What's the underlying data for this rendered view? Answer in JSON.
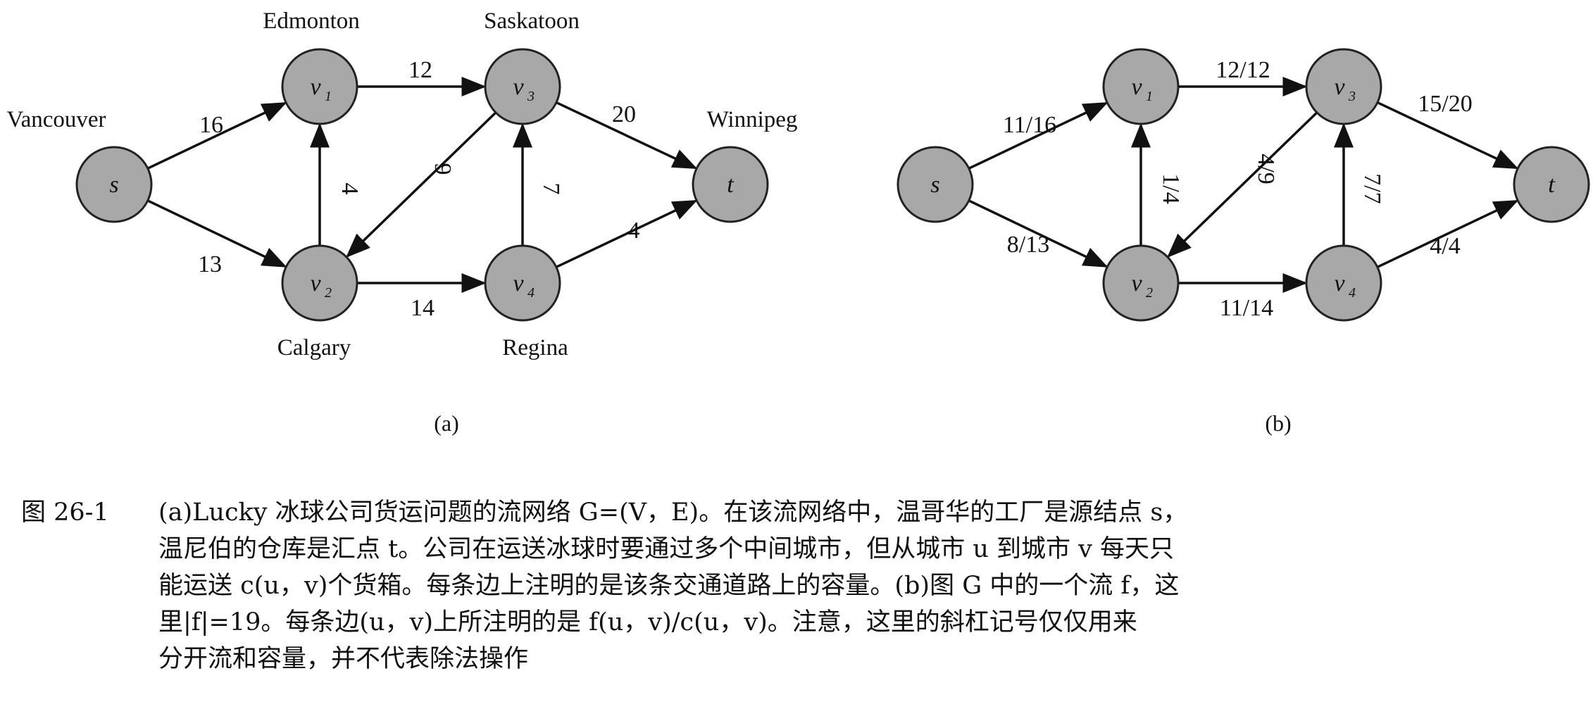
{
  "figure": {
    "panels": [
      {
        "id": "a",
        "panel_label": "(a)",
        "nodes": [
          {
            "id": "s",
            "label": "s",
            "sub": "",
            "city": "Vancouver"
          },
          {
            "id": "v1",
            "label": "v",
            "sub": "1",
            "city": "Edmonton"
          },
          {
            "id": "v2",
            "label": "v",
            "sub": "2",
            "city": "Calgary"
          },
          {
            "id": "v3",
            "label": "v",
            "sub": "3",
            "city": "Saskatoon"
          },
          {
            "id": "v4",
            "label": "v",
            "sub": "4",
            "city": "Regina"
          },
          {
            "id": "t",
            "label": "t",
            "sub": "",
            "city": "Winnipeg"
          }
        ],
        "edges": [
          {
            "from": "s",
            "to": "v1",
            "label": "16"
          },
          {
            "from": "s",
            "to": "v2",
            "label": "13"
          },
          {
            "from": "v2",
            "to": "v1",
            "label": "4"
          },
          {
            "from": "v1",
            "to": "v3",
            "label": "12"
          },
          {
            "from": "v3",
            "to": "v2",
            "label": "9"
          },
          {
            "from": "v2",
            "to": "v4",
            "label": "14"
          },
          {
            "from": "v4",
            "to": "v3",
            "label": "7"
          },
          {
            "from": "v3",
            "to": "t",
            "label": "20"
          },
          {
            "from": "v4",
            "to": "t",
            "label": "4"
          }
        ]
      },
      {
        "id": "b",
        "panel_label": "(b)",
        "nodes": [
          {
            "id": "s",
            "label": "s",
            "sub": "",
            "city": ""
          },
          {
            "id": "v1",
            "label": "v",
            "sub": "1",
            "city": ""
          },
          {
            "id": "v2",
            "label": "v",
            "sub": "2",
            "city": ""
          },
          {
            "id": "v3",
            "label": "v",
            "sub": "3",
            "city": ""
          },
          {
            "id": "v4",
            "label": "v",
            "sub": "4",
            "city": ""
          },
          {
            "id": "t",
            "label": "t",
            "sub": "",
            "city": ""
          }
        ],
        "edges": [
          {
            "from": "s",
            "to": "v1",
            "label": "11/16"
          },
          {
            "from": "s",
            "to": "v2",
            "label": "8/13"
          },
          {
            "from": "v2",
            "to": "v1",
            "label": "1/4"
          },
          {
            "from": "v1",
            "to": "v3",
            "label": "12/12"
          },
          {
            "from": "v3",
            "to": "v2",
            "label": "4/9"
          },
          {
            "from": "v2",
            "to": "v4",
            "label": "11/14"
          },
          {
            "from": "v4",
            "to": "v3",
            "label": "7/7"
          },
          {
            "from": "v3",
            "to": "t",
            "label": "15/20"
          },
          {
            "from": "v4",
            "to": "t",
            "label": "4/4"
          }
        ]
      }
    ]
  },
  "caption": {
    "number": "图 26-1",
    "lines": [
      "(a)Lucky 冰球公司货运问题的流网络 G=(V，E)。在该流网络中，温哥华的工厂是源结点 s，",
      "温尼伯的仓库是汇点 t。公司在运送冰球时要通过多个中间城市，但从城市 u 到城市 v 每天只",
      "能运送 c(u，v)个货箱。每条边上注明的是该条交通道路上的容量。(b)图 G 中的一个流 f，这",
      "里|f|=19。每条边(u，v)上所注明的是 f(u，v)/c(u，v)。注意，这里的斜杠记号仅仅用来",
      "分开流和容量，并不代表除法操作"
    ]
  }
}
